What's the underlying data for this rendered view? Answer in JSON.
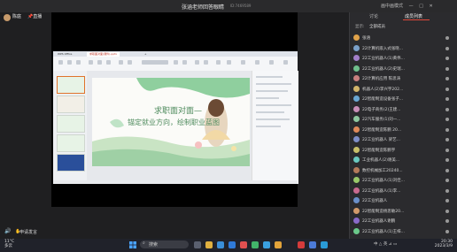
{
  "header": {
    "host_name": "陈庭",
    "follow_label": "直播",
    "title": "张涵老师回答眼睛",
    "room_id": "ID:7469589",
    "controls": [
      "画中画模式",
      "—",
      "□",
      "✕"
    ]
  },
  "document": {
    "tabs": [
      "WPS Office",
      "求职面对面(课件).pptx",
      "+"
    ],
    "slide": {
      "title": "求职面对面—",
      "subtitle": "锚定就业方向，绘制职业蓝图"
    }
  },
  "stage_footer": {
    "apply_label": "申请发言"
  },
  "panel": {
    "tabs": [
      "讨论",
      "成员列表"
    ],
    "active_tab": 1,
    "filter_label": "显示:",
    "filter_value": "全部成员",
    "members": [
      {
        "name": "张涵",
        "color": "#e0a24a"
      },
      {
        "name": "22计算机嵌入式张晓...",
        "color": "#7aa0c9"
      },
      {
        "name": "22工业机器人(1)黄伟...",
        "color": "#a37fc9"
      },
      {
        "name": "22工业机器人(2)史瑞...",
        "color": "#6fbf8c"
      },
      {
        "name": "22计算机应用 陈思涛",
        "color": "#c97f7f"
      },
      {
        "name": "机器人(2)李兴宇202...",
        "color": "#d2b56a"
      },
      {
        "name": "22智能制造设备张子...",
        "color": "#6aa7d2"
      },
      {
        "name": "22电子商务(2)王建...",
        "color": "#c98fb8"
      },
      {
        "name": "22汽车服务(1)刘一...",
        "color": "#8fc9a0"
      },
      {
        "name": "22智能制造陈鹏 20...",
        "color": "#e08a5a"
      },
      {
        "name": "22工业机器人 梁艺...",
        "color": "#7f8fc9"
      },
      {
        "name": "22智能制造陈鹏宇",
        "color": "#c9c06a"
      },
      {
        "name": "工业机器人(2)谢美...",
        "color": "#6ac9c0"
      },
      {
        "name": "数控机械加工20240...",
        "color": "#b37a5a"
      },
      {
        "name": "22工业机器人(1)刘佳...",
        "color": "#9ac96a"
      },
      {
        "name": "22工业机器人(1)李...",
        "color": "#c96a8f"
      },
      {
        "name": "22工业机器人",
        "color": "#6a8fc9"
      },
      {
        "name": "22智能制造杨思敏20...",
        "color": "#d29a6a"
      },
      {
        "name": "22工业机器人谢鹏",
        "color": "#8a6ac9"
      },
      {
        "name": "22工业机器人(1)王梓...",
        "color": "#6ac98a"
      }
    ]
  },
  "taskbar": {
    "weather_temp": "11°C",
    "weather_desc": "多云",
    "search_placeholder": "搜索",
    "tray": "中 △ 英 ⊿ ▭",
    "time": "20:30",
    "date": "2023/3/9"
  }
}
